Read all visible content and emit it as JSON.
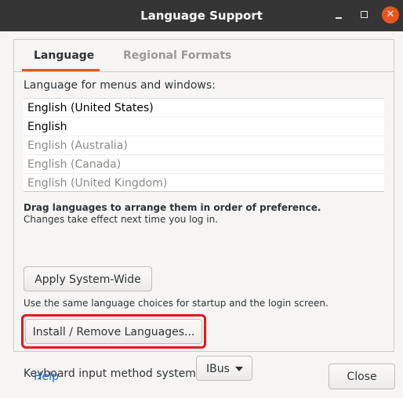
{
  "window": {
    "title": "Language Support",
    "controls": {
      "minimize": "minimize",
      "maximize": "maximize",
      "close": "✕"
    }
  },
  "tabs": [
    {
      "label": "Language",
      "active": true
    },
    {
      "label": "Regional Formats",
      "active": false
    }
  ],
  "language_section": {
    "heading": "Language for menus and windows:",
    "languages": [
      {
        "label": "English (United States)",
        "enabled": true
      },
      {
        "label": "English",
        "enabled": true
      },
      {
        "label": "English (Australia)",
        "enabled": false
      },
      {
        "label": "English (Canada)",
        "enabled": false
      },
      {
        "label": "English (United Kingdom)",
        "enabled": false
      }
    ],
    "drag_hint": "Drag languages to arrange them in order of preference.",
    "changes_hint": "Changes take effect next time you log in.",
    "apply_button": "Apply System-Wide",
    "use_same_hint": "Use the same language choices for startup and the login screen.",
    "install_button": "Install / Remove Languages...",
    "keyboard_label": "Keyboard input method system:",
    "keyboard_value": "IBus"
  },
  "footer": {
    "help_link": "Help",
    "close_button": "Close"
  },
  "colors": {
    "accent": "#e95420",
    "highlight_box": "#e8141c",
    "link": "#1b6acb",
    "titlebar": "#353535"
  }
}
